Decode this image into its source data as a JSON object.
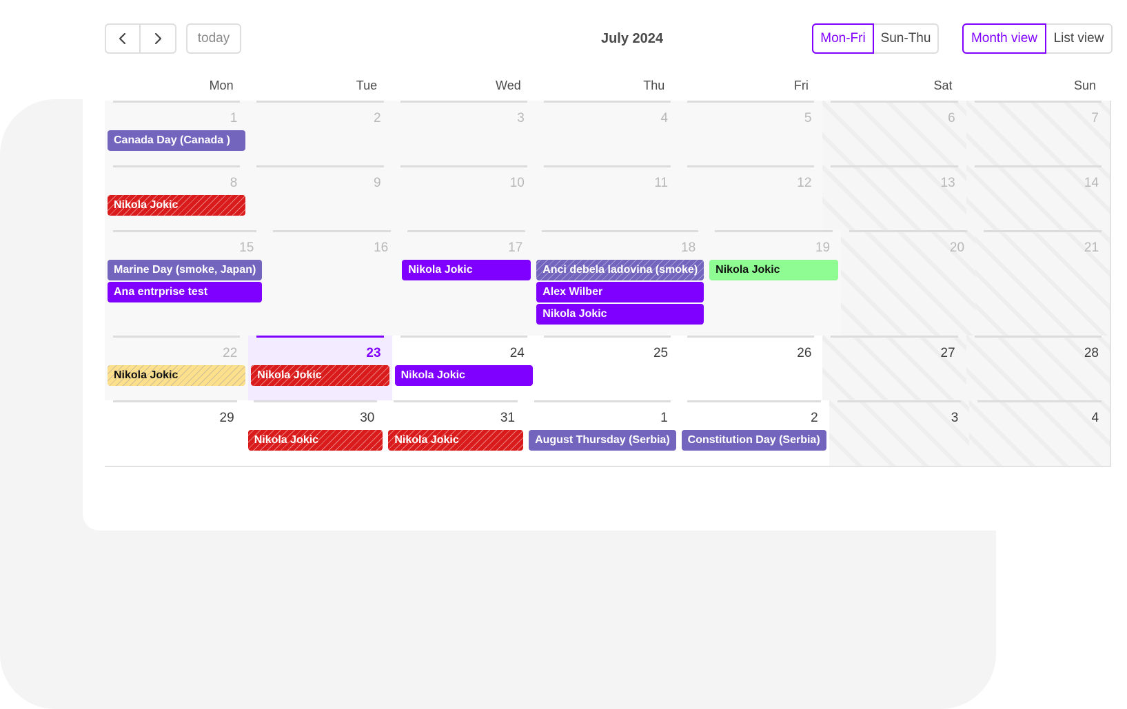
{
  "toolbar": {
    "prev_icon": "chevron-left-icon",
    "next_icon": "chevron-right-icon",
    "today_label": "today",
    "title": "July 2024",
    "week_options": [
      {
        "label": "Mon-Fri",
        "active": true
      },
      {
        "label": "Sun-Thu",
        "active": false
      }
    ],
    "view_options": [
      {
        "label": "Month view",
        "active": true
      },
      {
        "label": "List view",
        "active": false
      }
    ]
  },
  "colors": {
    "accent": "#8000ff",
    "holiday": "#7365bd",
    "absence_red": "#da1b1b",
    "green": "#8ffb93",
    "yellow": "#fde08c",
    "today_bg": "#f3ebff"
  },
  "calendar": {
    "weekdays": [
      "Mon",
      "Tue",
      "Wed",
      "Thu",
      "Fri",
      "Sat",
      "Sun"
    ],
    "weeks": [
      {
        "days": [
          {
            "num": "1",
            "state": "past",
            "events": [
              {
                "title": "Canada Day (Canada )",
                "type": "holiday"
              }
            ]
          },
          {
            "num": "2",
            "state": "past",
            "events": []
          },
          {
            "num": "3",
            "state": "past",
            "events": []
          },
          {
            "num": "4",
            "state": "past",
            "events": []
          },
          {
            "num": "5",
            "state": "past",
            "events": []
          },
          {
            "num": "6",
            "state": "weekend-past",
            "events": []
          },
          {
            "num": "7",
            "state": "weekend-past",
            "events": []
          }
        ]
      },
      {
        "days": [
          {
            "num": "8",
            "state": "past",
            "events": [
              {
                "title": "Nikola Jokic",
                "type": "red"
              }
            ]
          },
          {
            "num": "9",
            "state": "past",
            "events": []
          },
          {
            "num": "10",
            "state": "past",
            "events": []
          },
          {
            "num": "11",
            "state": "past",
            "events": []
          },
          {
            "num": "12",
            "state": "past",
            "events": []
          },
          {
            "num": "13",
            "state": "weekend-past",
            "events": []
          },
          {
            "num": "14",
            "state": "weekend-past",
            "events": []
          }
        ]
      },
      {
        "days": [
          {
            "num": "15",
            "state": "past",
            "events": [
              {
                "title": "Marine Day (smoke, Japan)",
                "type": "holiday"
              },
              {
                "title": "Ana entrprise test",
                "type": "purple"
              }
            ]
          },
          {
            "num": "16",
            "state": "past",
            "events": []
          },
          {
            "num": "17",
            "state": "past",
            "events": [
              {
                "title": "Nikola Jokic",
                "type": "purple"
              }
            ]
          },
          {
            "num": "18",
            "state": "past",
            "events": [
              {
                "title": "Anci debela ladovina (smoke)",
                "type": "holiday-striped"
              },
              {
                "title": "Alex Wilber",
                "type": "purple"
              },
              {
                "title": "Nikola Jokic",
                "type": "purple"
              }
            ]
          },
          {
            "num": "19",
            "state": "past",
            "events": [
              {
                "title": "Nikola Jokic",
                "type": "green"
              }
            ]
          },
          {
            "num": "20",
            "state": "weekend-past",
            "events": []
          },
          {
            "num": "21",
            "state": "weekend-past",
            "events": []
          }
        ]
      },
      {
        "days": [
          {
            "num": "22",
            "state": "past",
            "events": [
              {
                "title": "Nikola Jokic",
                "type": "yellow"
              }
            ]
          },
          {
            "num": "23",
            "state": "today",
            "events": [
              {
                "title": "Nikola Jokic",
                "type": "red"
              }
            ]
          },
          {
            "num": "24",
            "state": "current",
            "events": [
              {
                "title": "Nikola Jokic",
                "type": "purple"
              }
            ]
          },
          {
            "num": "25",
            "state": "current",
            "events": []
          },
          {
            "num": "26",
            "state": "current",
            "events": []
          },
          {
            "num": "27",
            "state": "weekend-current",
            "events": []
          },
          {
            "num": "28",
            "state": "weekend-current",
            "events": []
          }
        ]
      },
      {
        "days": [
          {
            "num": "29",
            "state": "current",
            "events": []
          },
          {
            "num": "30",
            "state": "current",
            "events": [
              {
                "title": "Nikola Jokic",
                "type": "red"
              }
            ]
          },
          {
            "num": "31",
            "state": "current",
            "events": [
              {
                "title": "Nikola Jokic",
                "type": "red"
              }
            ]
          },
          {
            "num": "1",
            "state": "current",
            "events": [
              {
                "title": "August Thursday (Serbia)",
                "type": "holiday"
              }
            ]
          },
          {
            "num": "2",
            "state": "current",
            "events": [
              {
                "title": "Constitution Day (Serbia)",
                "type": "holiday"
              }
            ]
          },
          {
            "num": "3",
            "state": "weekend-current",
            "events": []
          },
          {
            "num": "4",
            "state": "weekend-current",
            "events": []
          }
        ]
      }
    ]
  }
}
